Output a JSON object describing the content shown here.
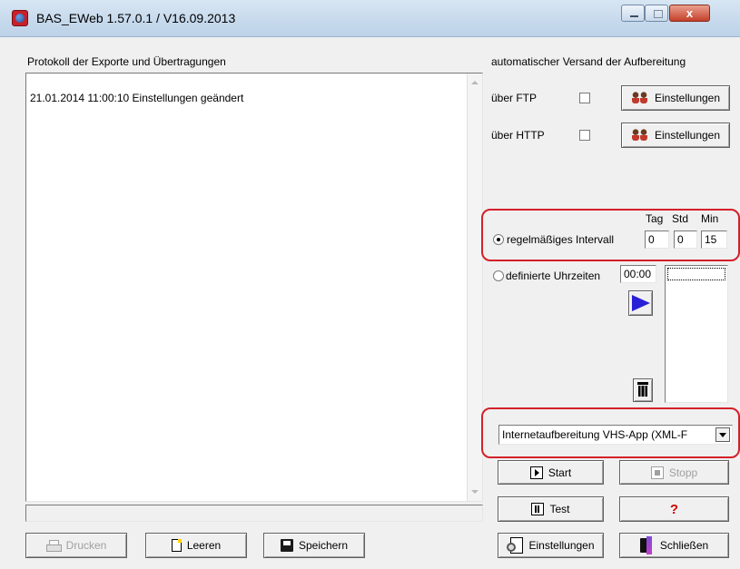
{
  "window": {
    "title": "BAS_EWeb 1.57.0.1 / V16.09.2013",
    "close_glyph": "x"
  },
  "log": {
    "heading": "Protokoll der Exporte und Übertragungen",
    "entries": [
      "21.01.2014 11:00:10 Einstellungen geändert"
    ]
  },
  "dispatch": {
    "heading": "automatischer Versand der Aufbereitung",
    "ftp_label": "über FTP",
    "ftp_checked": false,
    "http_label": "über HTTP",
    "http_checked": false,
    "settings_label": "Einstellungen"
  },
  "schedule": {
    "col_tag": "Tag",
    "col_std": "Std",
    "col_min": "Min",
    "interval_label": "regelmäßiges Intervall",
    "interval_selected": true,
    "tag_value": "0",
    "std_value": "0",
    "min_value": "15",
    "times_label": "definierte Uhrzeiten",
    "time_value": "00:00"
  },
  "preparation": {
    "selected": "Internetaufbereitung VHS-App (XML-F"
  },
  "buttons": {
    "start": "Start",
    "stop": "Stopp",
    "test": "Test",
    "help": "?",
    "print": "Drucken",
    "clear": "Leeren",
    "save": "Speichern",
    "settings": "Einstellungen",
    "close": "Schließen"
  },
  "colors": {
    "highlight_outline": "#d4202a",
    "window_bg": "#f0f0f0"
  }
}
